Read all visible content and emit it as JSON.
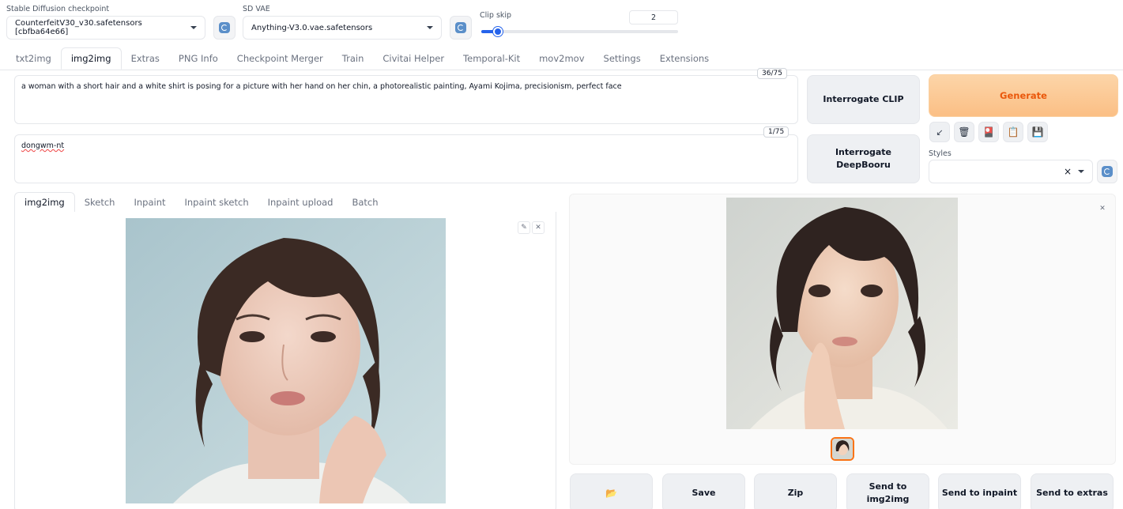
{
  "top": {
    "checkpoint_label": "Stable Diffusion checkpoint",
    "checkpoint_value": "CounterfeitV30_v30.safetensors [cbfba64e66]",
    "vae_label": "SD VAE",
    "vae_value": "Anything-V3.0.vae.safetensors",
    "clip_label": "Clip skip",
    "clip_value": "2",
    "clip_fraction": 0.083
  },
  "main_tabs": [
    "txt2img",
    "img2img",
    "Extras",
    "PNG Info",
    "Checkpoint Merger",
    "Train",
    "Civitai Helper",
    "Temporal-Kit",
    "mov2mov",
    "Settings",
    "Extensions"
  ],
  "prompt": {
    "positive": "a woman with a short hair and a white shirt is posing for a picture with her hand on her chin, a photorealistic painting, Ayami Kojima, precisionism, perfect face",
    "positive_count": "36/75",
    "negative": "dongwm-nt",
    "negative_count": "1/75"
  },
  "buttons": {
    "interrogate_clip": "Interrogate CLIP",
    "interrogate_deepbooru": "Interrogate DeepBooru",
    "generate": "Generate"
  },
  "styles": {
    "label": "Styles",
    "clear": "×"
  },
  "sub_tabs": [
    "img2img",
    "Sketch",
    "Inpaint",
    "Inpaint sketch",
    "Inpaint upload",
    "Batch"
  ],
  "output_buttons": {
    "folder": "📂",
    "save": "Save",
    "zip": "Zip",
    "send_img2img": "Send to img2img",
    "send_inpaint": "Send to inpaint",
    "send_extras": "Send to extras"
  },
  "icons": {
    "arrow": "↙",
    "trash": "🗑",
    "card": "🎴",
    "clipboard": "📋",
    "save": "💾"
  }
}
